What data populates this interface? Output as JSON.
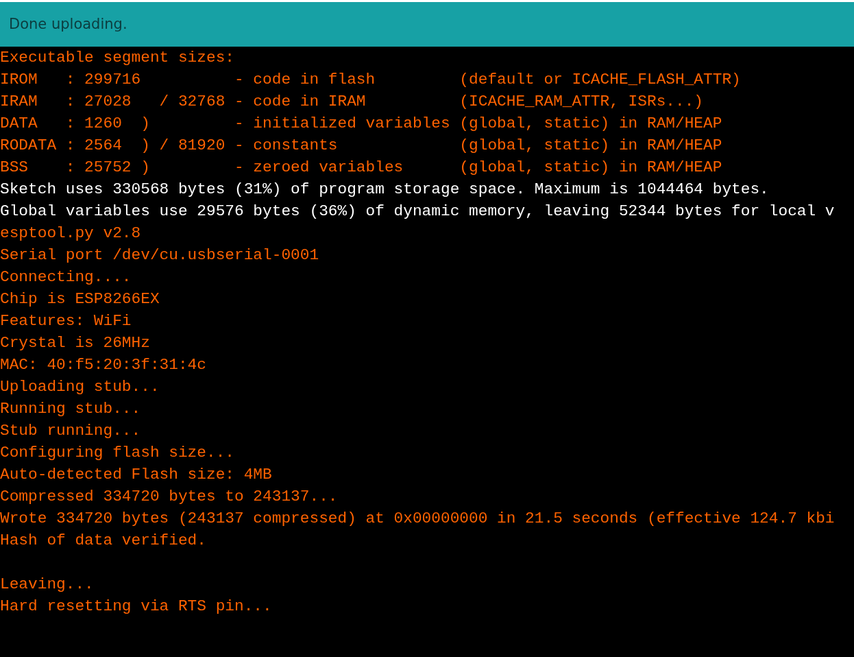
{
  "status_bar": {
    "message": "Done uploading."
  },
  "console": {
    "lines": [
      {
        "text": "Executable segment sizes:",
        "kind": "error"
      },
      {
        "text": "IROM   : 299716          - code in flash         (default or ICACHE_FLASH_ATTR)",
        "kind": "error"
      },
      {
        "text": "IRAM   : 27028   / 32768 - code in IRAM          (ICACHE_RAM_ATTR, ISRs...)",
        "kind": "error"
      },
      {
        "text": "DATA   : 1260  )         - initialized variables (global, static) in RAM/HEAP",
        "kind": "error"
      },
      {
        "text": "RODATA : 2564  ) / 81920 - constants             (global, static) in RAM/HEAP",
        "kind": "error"
      },
      {
        "text": "BSS    : 25752 )         - zeroed variables      (global, static) in RAM/HEAP",
        "kind": "error"
      },
      {
        "text": "Sketch uses 330568 bytes (31%) of program storage space. Maximum is 1044464 bytes.",
        "kind": "output"
      },
      {
        "text": "Global variables use 29576 bytes (36%) of dynamic memory, leaving 52344 bytes for local v",
        "kind": "output"
      },
      {
        "text": "esptool.py v2.8",
        "kind": "error"
      },
      {
        "text": "Serial port /dev/cu.usbserial-0001",
        "kind": "error"
      },
      {
        "text": "Connecting....",
        "kind": "error"
      },
      {
        "text": "Chip is ESP8266EX",
        "kind": "error"
      },
      {
        "text": "Features: WiFi",
        "kind": "error"
      },
      {
        "text": "Crystal is 26MHz",
        "kind": "error"
      },
      {
        "text": "MAC: 40:f5:20:3f:31:4c",
        "kind": "error"
      },
      {
        "text": "Uploading stub...",
        "kind": "error"
      },
      {
        "text": "Running stub...",
        "kind": "error"
      },
      {
        "text": "Stub running...",
        "kind": "error"
      },
      {
        "text": "Configuring flash size...",
        "kind": "error"
      },
      {
        "text": "Auto-detected Flash size: 4MB",
        "kind": "error"
      },
      {
        "text": "Compressed 334720 bytes to 243137...",
        "kind": "error"
      },
      {
        "text": "Wrote 334720 bytes (243137 compressed) at 0x00000000 in 21.5 seconds (effective 124.7 kbi",
        "kind": "error"
      },
      {
        "text": "Hash of data verified.",
        "kind": "error"
      },
      {
        "kind": "blank"
      },
      {
        "text": "Leaving...",
        "kind": "error"
      },
      {
        "text": "Hard resetting via RTS pin...",
        "kind": "error"
      }
    ]
  }
}
